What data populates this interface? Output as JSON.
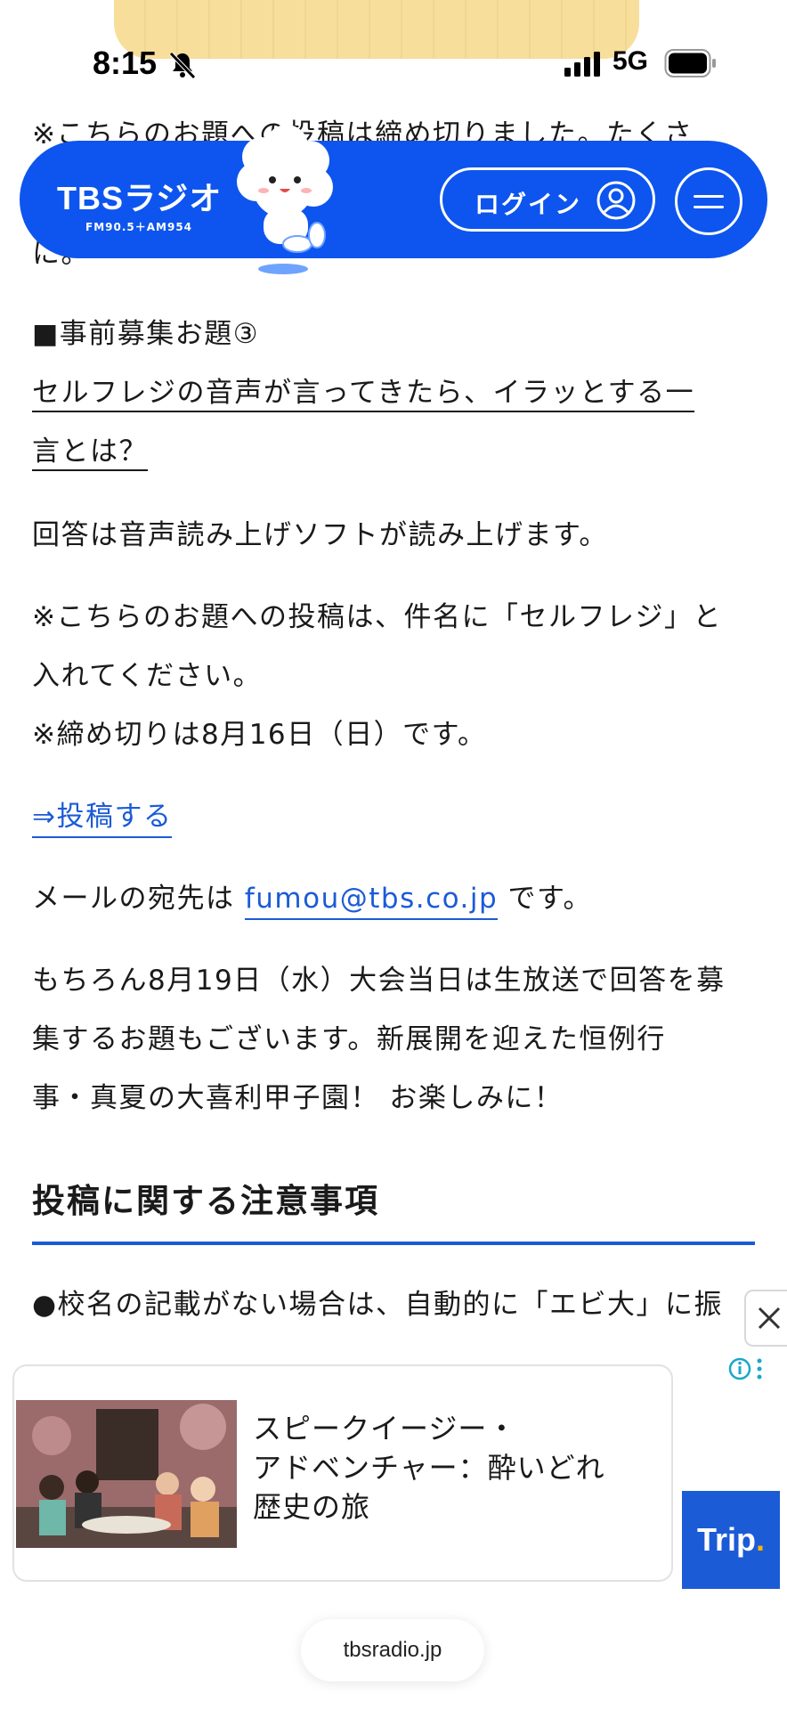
{
  "status_bar": {
    "time": "8:15",
    "network": "5G",
    "icons": [
      "bell-slash-icon",
      "cellular-signal-icon",
      "battery-icon"
    ]
  },
  "header": {
    "logo_main": "TBSラジオ",
    "logo_sub": "FM90.5＋AM954",
    "login_label": "ログイン",
    "icons": [
      "user-icon",
      "menu-icon",
      "mascot-icon"
    ],
    "bg_color": "#0d55ee"
  },
  "article": {
    "cutoff_line_top": "※こちらのお題への投稿は締め切りました。たくさ",
    "cutoff_line_bottom": "に。",
    "section3_heading": "■事前募集お題③",
    "section3_question_line1": "セルフレジの音声が言ってきたら、イラッとする一",
    "section3_question_line2": "言とは？",
    "answer_note": "回答は音声読み上げソフトが読み上げます。",
    "subject_note_line1": "※こちらのお題への投稿は、件名に「セルフレジ」と",
    "subject_note_line2": "入れてください。",
    "deadline": "※締め切りは8月16日（日）です。",
    "post_link": "⇒投稿する",
    "mail_prefix": "メールの宛先は ",
    "mail_address": "fumou@tbs.co.jp",
    "mail_suffix": " です。",
    "live_line1": "もちろん8月19日（水）大会当日は生放送で回答を募",
    "live_line2": "集するお題もございます。新展開を迎えた恒例行",
    "live_line3": "事・真夏の大喜利甲子園！ お楽しみに！",
    "notes_heading": "投稿に関する注意事項",
    "notes_first": "●校名の記載がない場合は、自動的に「エビ大」に振",
    "accent_color": "#1b5bd6"
  },
  "ad": {
    "title": "スピークイージー・\nアドベンチャー：酔いどれ\n歴史の旅",
    "brand": "Trip",
    "brand_dot": ".",
    "icons": [
      "close-icon",
      "info-icon",
      "more-vertical-icon"
    ]
  },
  "browser": {
    "url": "tbsradio.jp"
  }
}
